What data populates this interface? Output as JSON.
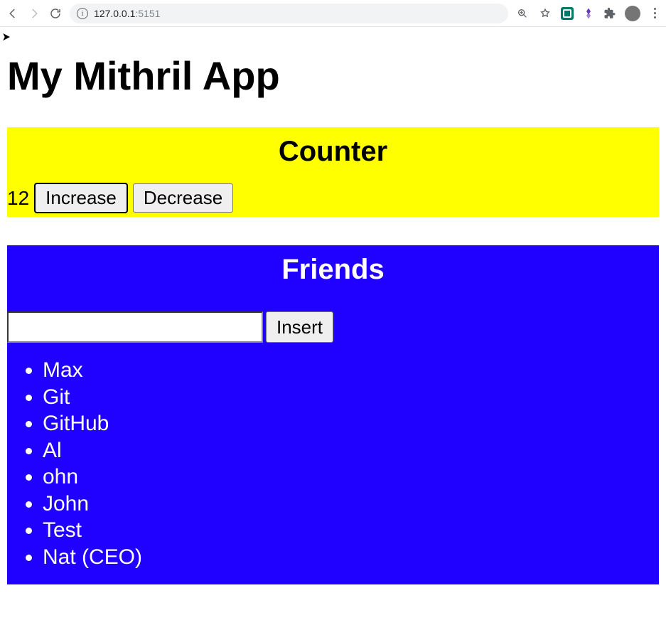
{
  "browser": {
    "url_host": "127.0.0.1",
    "url_port": ":5151"
  },
  "page": {
    "title": "My Mithril App"
  },
  "counter": {
    "heading": "Counter",
    "value": "12",
    "increase_label": "Increase",
    "decrease_label": "Decrease"
  },
  "friends": {
    "heading": "Friends",
    "input_value": "",
    "insert_label": "Insert",
    "items": [
      "Max",
      "Git",
      "GitHub",
      "Al",
      "ohn",
      "John",
      "Test",
      "Nat (CEO)"
    ]
  }
}
